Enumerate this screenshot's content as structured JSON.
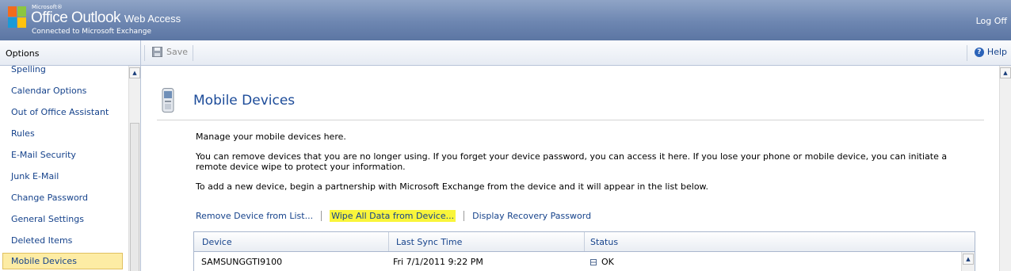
{
  "header": {
    "brand_small": "Microsoft®",
    "brand_main": "Office Outlook",
    "brand_sub": "Web Access",
    "tagline": "Connected to Microsoft Exchange",
    "logoff": "Log Off"
  },
  "left_panel": {
    "title": "Options",
    "items": [
      {
        "label": "Spelling"
      },
      {
        "label": "Calendar Options"
      },
      {
        "label": "Out of Office Assistant"
      },
      {
        "label": "Rules"
      },
      {
        "label": "E-Mail Security"
      },
      {
        "label": "Junk E-Mail"
      },
      {
        "label": "Change Password"
      },
      {
        "label": "General Settings"
      },
      {
        "label": "Deleted Items"
      },
      {
        "label": "Mobile Devices",
        "selected": true
      }
    ]
  },
  "toolbar": {
    "save": "Save",
    "help": "Help",
    "help_icon": "?"
  },
  "main": {
    "title": "Mobile Devices",
    "intro": "Manage your mobile devices here.",
    "paragraph2": "You can remove devices that you are no longer using. If you forget your device password, you can access it here. If you lose your phone or mobile device, you can initiate a remote device wipe to protect your information.",
    "paragraph3": "To add a new device, begin a partnership with Microsoft Exchange from the device and it will appear in the list below.",
    "actions": {
      "remove": "Remove Device from List...",
      "wipe": "Wipe All Data from Device...",
      "recovery": "Display Recovery Password"
    },
    "highlight_color": "#f9f53a",
    "table": {
      "columns": [
        "Device",
        "Last Sync Time",
        "Status"
      ],
      "rows": [
        {
          "device": "SAMSUNGGTI9100",
          "last_sync": "Fri 7/1/2011 9:22 PM",
          "status": "OK"
        }
      ]
    }
  },
  "colors": {
    "header_blue": "#6d86b1",
    "link_blue": "#15428b",
    "title_blue": "#1c4b99",
    "selected_bg": "#fdeca4"
  },
  "icons": {
    "logo": "office-logo-icon",
    "save": "floppy-disk-icon",
    "help": "help-icon",
    "device": "mobile-phone-icon",
    "status": "status-ok-icon"
  }
}
